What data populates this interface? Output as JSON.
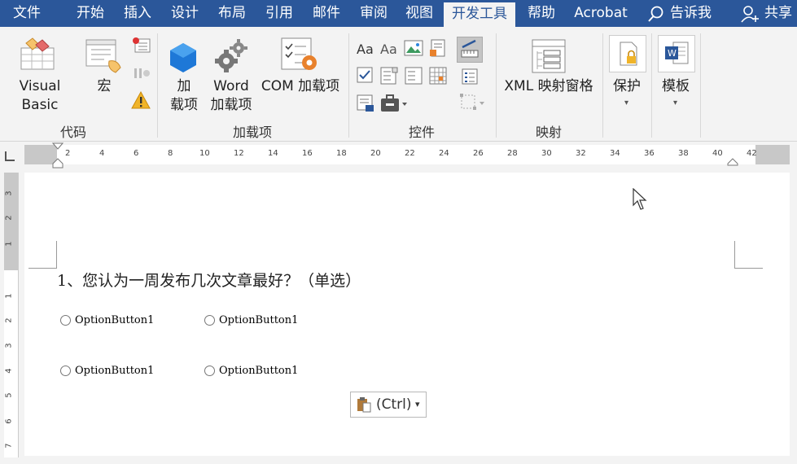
{
  "menu": {
    "tabs": [
      "文件",
      "开始",
      "插入",
      "设计",
      "布局",
      "引用",
      "邮件",
      "审阅",
      "视图",
      "开发工具",
      "帮助",
      "Acrobat"
    ],
    "active_tab": "开发工具",
    "tell_me": "告诉我",
    "share": "共享"
  },
  "ribbon": {
    "code": {
      "label": "代码",
      "visual_basic": "Visual Basic",
      "macro": "宏"
    },
    "addins": {
      "label": "加载项",
      "addins_line1": "加",
      "addins_line2": "载项",
      "word_line1": "Word",
      "word_line2": "加载项",
      "com": "COM 加载项"
    },
    "controls": {
      "label": "控件"
    },
    "mapping": {
      "label": "映射",
      "xml_pane": "XML 映射窗格"
    },
    "protect": {
      "label": "保护"
    },
    "templates": {
      "label": "模板"
    }
  },
  "ruler": {
    "numbers": [
      "2",
      "4",
      "6",
      "8",
      "10",
      "12",
      "14",
      "16",
      "18",
      "20",
      "22",
      "24",
      "26",
      "28",
      "30",
      "32",
      "34",
      "36",
      "38",
      "40",
      "42"
    ],
    "vertical_numbers": [
      "3",
      "2",
      "1",
      "1",
      "2",
      "3",
      "4",
      "5",
      "6",
      "7"
    ]
  },
  "document": {
    "question": "1、您认为一周发布几次文章最好？（单选）",
    "options": [
      "OptionButton1",
      "OptionButton1",
      "OptionButton1",
      "OptionButton1"
    ],
    "paste_label": "(Ctrl)"
  },
  "colors": {
    "menubar": "#2b579a",
    "ribbon": "#f3f3f3"
  }
}
